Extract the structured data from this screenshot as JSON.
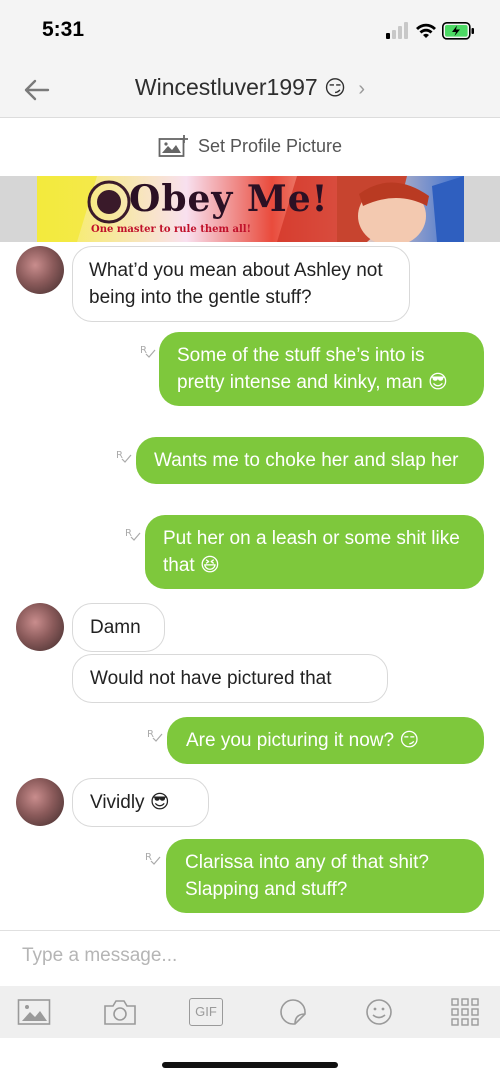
{
  "status_bar": {
    "time": "5:31"
  },
  "header": {
    "contact_name": "Wincestluver1997",
    "name_emoji": "😏",
    "chevron": "›"
  },
  "profile": {
    "set_picture_label": "Set Profile Picture"
  },
  "banner": {
    "title": "Obey Me!",
    "tagline": "One master to rule them all!"
  },
  "messages": [
    {
      "dir": "in",
      "text": "What’d you mean about Ashley not being into the gentle stuff?"
    },
    {
      "dir": "out",
      "text": "Some of the stuff she’s into is pretty intense and kinky, man 😎"
    },
    {
      "dir": "out",
      "text": "Wants me to choke her and slap her"
    },
    {
      "dir": "out",
      "text": "Put her on a leash or some shit like that 😆"
    },
    {
      "dir": "in",
      "text": "Damn"
    },
    {
      "dir": "in",
      "text": "Would not have pictured that"
    },
    {
      "dir": "out",
      "text": "Are you picturing it now? 😏"
    },
    {
      "dir": "in",
      "text": "Vividly 😎"
    },
    {
      "dir": "out",
      "text": "Clarissa into any of that shit? Slapping and stuff?"
    }
  ],
  "composer": {
    "placeholder": "Type a message..."
  },
  "toolbar": {
    "gif_label": "GIF"
  },
  "icons": {
    "back": "back-arrow-icon",
    "camera_add": "image-add-icon",
    "read_receipt": "read-receipt-icon",
    "gallery": "gallery-icon",
    "camera": "camera-icon",
    "gif": "gif-icon",
    "sticker": "sticker-icon",
    "emoji": "emoji-icon",
    "more": "grid-more-icon"
  },
  "colors": {
    "outgoing_bubble": "#7ec83c",
    "incoming_bubble": "#ffffff",
    "header_bg": "#f4f4f4",
    "battery": "#4cd964"
  }
}
